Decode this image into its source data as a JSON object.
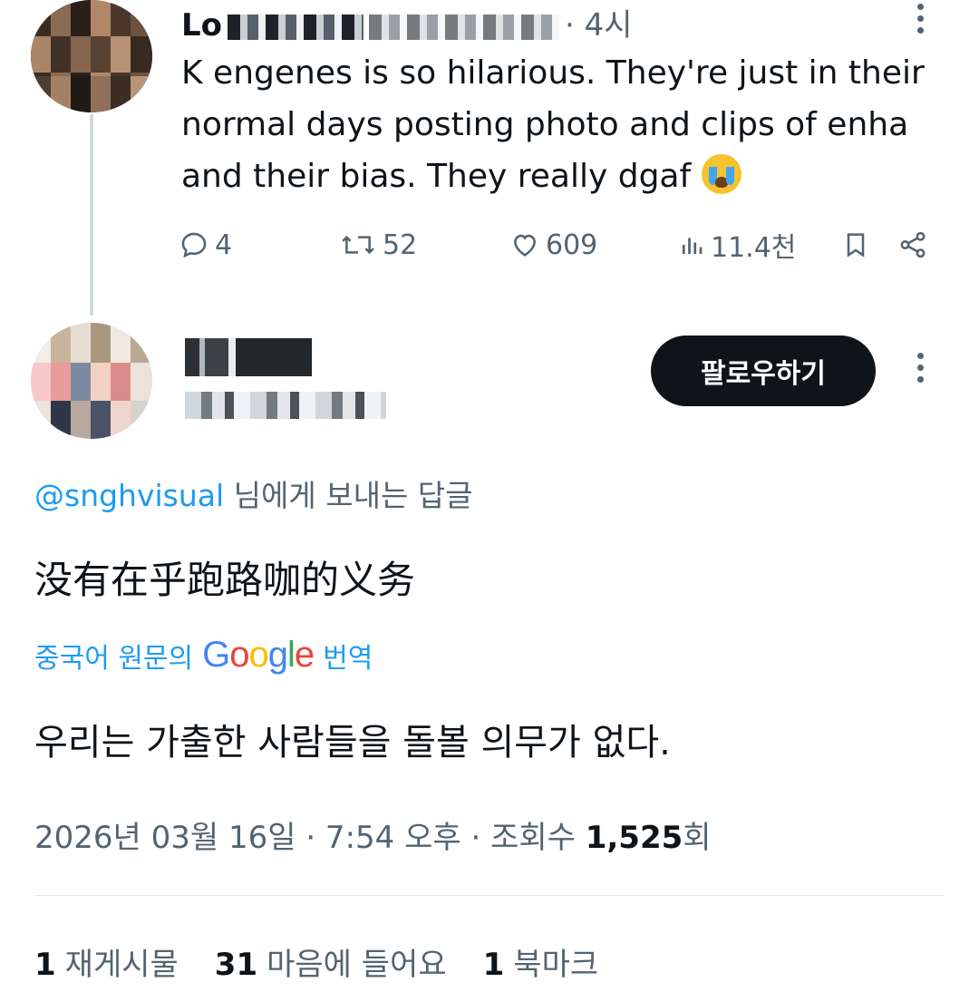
{
  "tweet1": {
    "name": "Lo",
    "time": "· 4시",
    "body": "K engenes is so hilarious. They're just in their normal days posting photo and clips of enha and their bias. They really dgaf",
    "emoji": "loudly-crying-face",
    "actions": {
      "replies": "4",
      "retweets": "52",
      "likes": "609",
      "views": "11.4천"
    }
  },
  "tweet2": {
    "follow_label": "팔로우하기",
    "reply_to_mention": "@snghvisual",
    "reply_to_suffix": " 님에게 보내는 답글",
    "body": "没有在乎跑路咖的义务",
    "translate_prefix": "중국어 원문의",
    "translate_google": "Google",
    "translate_suffix": "번역",
    "translated_text": "우리는 가출한 사람들을 돌볼 의무가 없다.",
    "meta_date": "2026년 03월 16일 · 7:54 오후 · 조회수 ",
    "meta_views": "1,525",
    "meta_views_suffix": "회",
    "stats": {
      "reposts_count": "1",
      "reposts_label": "재게시물",
      "likes_count": "31",
      "likes_label": "마음에 들어요",
      "bookmarks_count": "1",
      "bookmarks_label": "북마크"
    }
  },
  "colors": {
    "text": "#0f1419",
    "secondary": "#536471",
    "accent": "#1d9bf0",
    "button": "#0f1419"
  }
}
